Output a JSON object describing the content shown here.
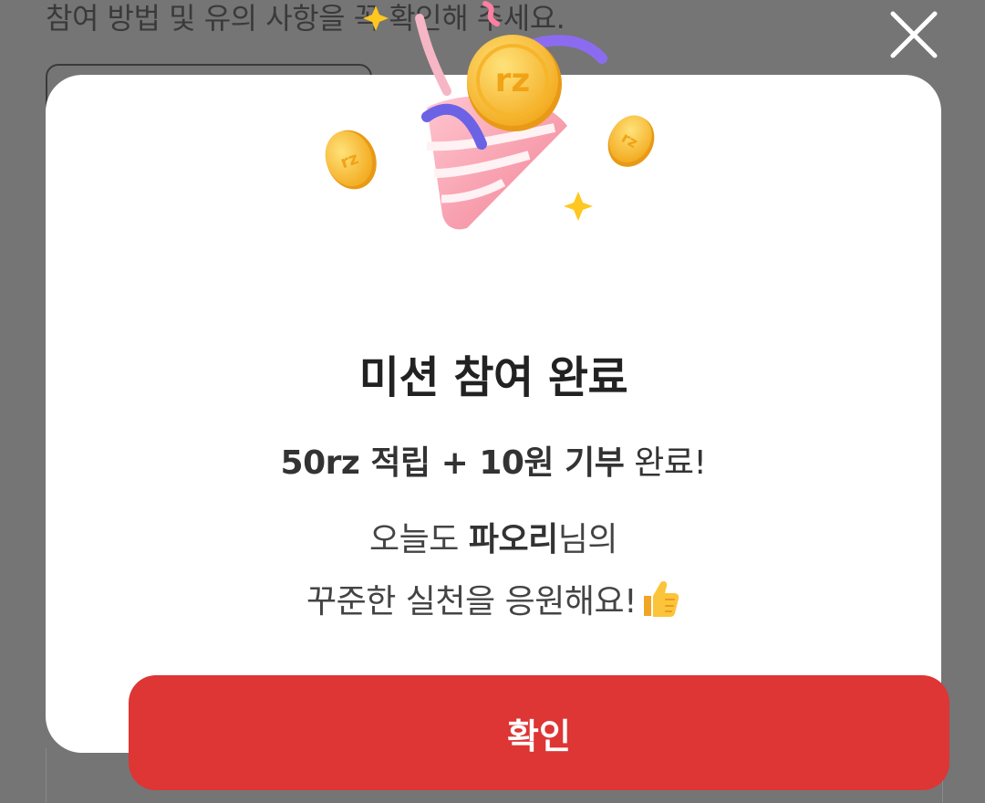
{
  "background": {
    "instruction_text": "참여 방법 및 유의 사항을 꼭 확인해 주세요."
  },
  "modal": {
    "title": "미션 참여 완료",
    "reward_bold": "50rz 적립 + 10원 기부",
    "reward_tail": " 완료!",
    "message_line1_pre": "오늘도 ",
    "message_name": "파오리",
    "message_line1_post": "님의",
    "message_line2": "꾸준한 실천을 응원해요!",
    "coin_logo": "rz",
    "confirm_label": "확인"
  },
  "icons": {
    "close": "close-icon",
    "thumbs_up": "thumbs-up-icon",
    "illustration": "party-popper-with-coins"
  },
  "colors": {
    "overlay": "#757575",
    "primary": "#de3535",
    "coin": "#f7b928"
  }
}
